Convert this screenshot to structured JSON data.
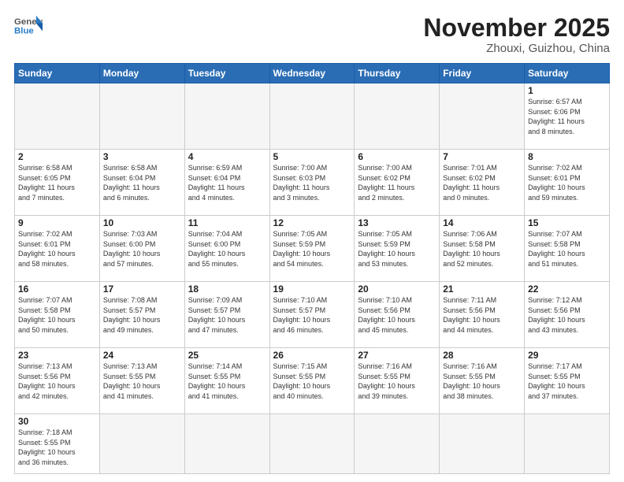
{
  "header": {
    "logo_general": "General",
    "logo_blue": "Blue",
    "month_title": "November 2025",
    "location": "Zhouxi, Guizhou, China"
  },
  "weekdays": [
    "Sunday",
    "Monday",
    "Tuesday",
    "Wednesday",
    "Thursday",
    "Friday",
    "Saturday"
  ],
  "weeks": [
    [
      {
        "day": "",
        "empty": true
      },
      {
        "day": "",
        "empty": true
      },
      {
        "day": "",
        "empty": true
      },
      {
        "day": "",
        "empty": true
      },
      {
        "day": "",
        "empty": true
      },
      {
        "day": "",
        "empty": true
      },
      {
        "day": "1",
        "info": "Sunrise: 6:57 AM\nSunset: 6:06 PM\nDaylight: 11 hours\nand 8 minutes."
      }
    ],
    [
      {
        "day": "2",
        "info": "Sunrise: 6:58 AM\nSunset: 6:05 PM\nDaylight: 11 hours\nand 7 minutes."
      },
      {
        "day": "3",
        "info": "Sunrise: 6:58 AM\nSunset: 6:04 PM\nDaylight: 11 hours\nand 6 minutes."
      },
      {
        "day": "4",
        "info": "Sunrise: 6:59 AM\nSunset: 6:04 PM\nDaylight: 11 hours\nand 4 minutes."
      },
      {
        "day": "5",
        "info": "Sunrise: 7:00 AM\nSunset: 6:03 PM\nDaylight: 11 hours\nand 3 minutes."
      },
      {
        "day": "6",
        "info": "Sunrise: 7:00 AM\nSunset: 6:02 PM\nDaylight: 11 hours\nand 2 minutes."
      },
      {
        "day": "7",
        "info": "Sunrise: 7:01 AM\nSunset: 6:02 PM\nDaylight: 11 hours\nand 0 minutes."
      },
      {
        "day": "8",
        "info": "Sunrise: 7:02 AM\nSunset: 6:01 PM\nDaylight: 10 hours\nand 59 minutes."
      }
    ],
    [
      {
        "day": "9",
        "info": "Sunrise: 7:02 AM\nSunset: 6:01 PM\nDaylight: 10 hours\nand 58 minutes."
      },
      {
        "day": "10",
        "info": "Sunrise: 7:03 AM\nSunset: 6:00 PM\nDaylight: 10 hours\nand 57 minutes."
      },
      {
        "day": "11",
        "info": "Sunrise: 7:04 AM\nSunset: 6:00 PM\nDaylight: 10 hours\nand 55 minutes."
      },
      {
        "day": "12",
        "info": "Sunrise: 7:05 AM\nSunset: 5:59 PM\nDaylight: 10 hours\nand 54 minutes."
      },
      {
        "day": "13",
        "info": "Sunrise: 7:05 AM\nSunset: 5:59 PM\nDaylight: 10 hours\nand 53 minutes."
      },
      {
        "day": "14",
        "info": "Sunrise: 7:06 AM\nSunset: 5:58 PM\nDaylight: 10 hours\nand 52 minutes."
      },
      {
        "day": "15",
        "info": "Sunrise: 7:07 AM\nSunset: 5:58 PM\nDaylight: 10 hours\nand 51 minutes."
      }
    ],
    [
      {
        "day": "16",
        "info": "Sunrise: 7:07 AM\nSunset: 5:58 PM\nDaylight: 10 hours\nand 50 minutes."
      },
      {
        "day": "17",
        "info": "Sunrise: 7:08 AM\nSunset: 5:57 PM\nDaylight: 10 hours\nand 49 minutes."
      },
      {
        "day": "18",
        "info": "Sunrise: 7:09 AM\nSunset: 5:57 PM\nDaylight: 10 hours\nand 47 minutes."
      },
      {
        "day": "19",
        "info": "Sunrise: 7:10 AM\nSunset: 5:57 PM\nDaylight: 10 hours\nand 46 minutes."
      },
      {
        "day": "20",
        "info": "Sunrise: 7:10 AM\nSunset: 5:56 PM\nDaylight: 10 hours\nand 45 minutes."
      },
      {
        "day": "21",
        "info": "Sunrise: 7:11 AM\nSunset: 5:56 PM\nDaylight: 10 hours\nand 44 minutes."
      },
      {
        "day": "22",
        "info": "Sunrise: 7:12 AM\nSunset: 5:56 PM\nDaylight: 10 hours\nand 43 minutes."
      }
    ],
    [
      {
        "day": "23",
        "info": "Sunrise: 7:13 AM\nSunset: 5:56 PM\nDaylight: 10 hours\nand 42 minutes."
      },
      {
        "day": "24",
        "info": "Sunrise: 7:13 AM\nSunset: 5:55 PM\nDaylight: 10 hours\nand 41 minutes."
      },
      {
        "day": "25",
        "info": "Sunrise: 7:14 AM\nSunset: 5:55 PM\nDaylight: 10 hours\nand 41 minutes."
      },
      {
        "day": "26",
        "info": "Sunrise: 7:15 AM\nSunset: 5:55 PM\nDaylight: 10 hours\nand 40 minutes."
      },
      {
        "day": "27",
        "info": "Sunrise: 7:16 AM\nSunset: 5:55 PM\nDaylight: 10 hours\nand 39 minutes."
      },
      {
        "day": "28",
        "info": "Sunrise: 7:16 AM\nSunset: 5:55 PM\nDaylight: 10 hours\nand 38 minutes."
      },
      {
        "day": "29",
        "info": "Sunrise: 7:17 AM\nSunset: 5:55 PM\nDaylight: 10 hours\nand 37 minutes."
      }
    ],
    [
      {
        "day": "30",
        "info": "Sunrise: 7:18 AM\nSunset: 5:55 PM\nDaylight: 10 hours\nand 36 minutes.",
        "last": true
      },
      {
        "day": "",
        "empty": true,
        "last": true
      },
      {
        "day": "",
        "empty": true,
        "last": true
      },
      {
        "day": "",
        "empty": true,
        "last": true
      },
      {
        "day": "",
        "empty": true,
        "last": true
      },
      {
        "day": "",
        "empty": true,
        "last": true
      },
      {
        "day": "",
        "empty": true,
        "last": true
      }
    ]
  ]
}
